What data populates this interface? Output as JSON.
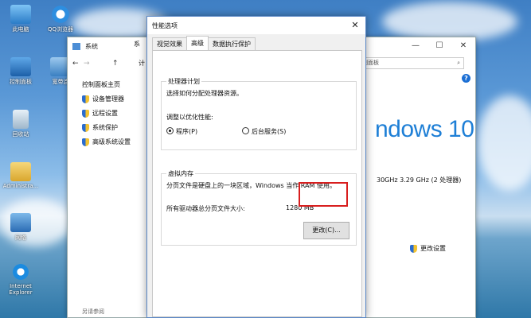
{
  "desktop": {
    "icons": [
      {
        "label": "此电脑"
      },
      {
        "label": "QQ浏览器"
      },
      {
        "label": "控制面板"
      },
      {
        "label": "宽带连"
      },
      {
        "label": "回收站"
      },
      {
        "label": "Administra..."
      },
      {
        "label": "网络"
      },
      {
        "label": "Internet Explorer"
      }
    ]
  },
  "system_window": {
    "title": "系统",
    "title_partial": "系",
    "search_placeholder": "控制面板",
    "tab_partial": "计",
    "left_home": "控制面板主页",
    "left_links": [
      "设备管理器",
      "远程设置",
      "系统保护",
      "高级系统设置"
    ],
    "see_also": "另请参阅",
    "windows_brand": "ndows 10",
    "cpu_info": "30GHz   3.29 GHz (2 处理器)",
    "change_settings": "更改设置",
    "help": "?"
  },
  "dialog": {
    "title": "性能选项",
    "close": "✕",
    "tabs": [
      "视觉效果",
      "高级",
      "数据执行保护"
    ],
    "active_tab": "高级",
    "processor": {
      "group_label": "处理器计划",
      "description": "选择如何分配处理器资源。",
      "adjust_label": "调整以优化性能:",
      "option_programs": "程序(P)",
      "option_services": "后台服务(S)",
      "selected": "程序(P)"
    },
    "virtual_memory": {
      "group_label": "虚拟内存",
      "description": "分页文件是硬盘上的一块区域，Windows 当作 RAM 使用。",
      "total_label": "所有驱动器总分页文件大小:",
      "total_value": "1280 MB",
      "change_button": "更改(C)..."
    }
  },
  "colors": {
    "highlight": "#d81e1e",
    "accent": "#1e7fd6"
  }
}
